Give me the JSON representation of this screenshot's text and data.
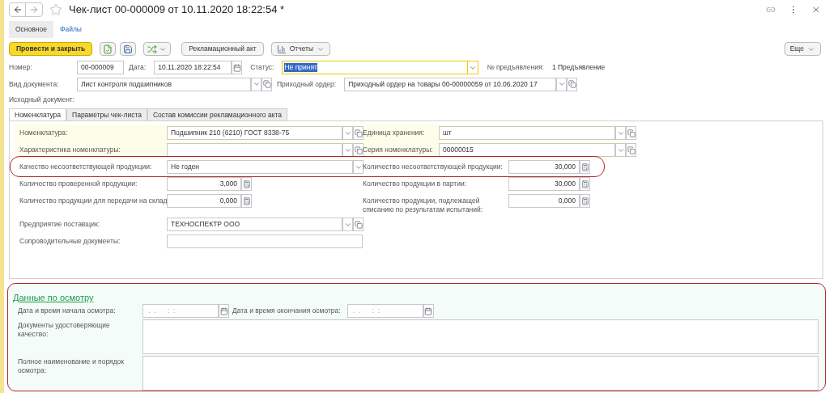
{
  "window": {
    "title": "Чек-лист 00-000009 от 10.11.2020 18:22:54 *",
    "favorite": false
  },
  "section_tabs": [
    {
      "label": "Основное",
      "selected": true
    },
    {
      "label": "Файлы",
      "selected": false
    }
  ],
  "toolbar": {
    "post_and_close": "Провести и закрыть",
    "claim_act": "Рекламационный акт",
    "reports": "Отчеты",
    "more": "Еще"
  },
  "header": {
    "number": {
      "label": "Номер:",
      "value": "00-000009"
    },
    "date": {
      "label": "Дата:",
      "value": "10.11.2020 18:22:54"
    },
    "status": {
      "label": "Статус:",
      "value": "Не принят",
      "text_selected": true
    },
    "presentation": {
      "label": "№ предъявления:",
      "value": "1 Предъявление"
    },
    "document_type": {
      "label": "Вид документа:",
      "value": "Лист контроля подшипников"
    },
    "receipt_order": {
      "label": "Приходный ордер:",
      "value": "Приходный ордер на товары 00-00000059 от 10.06.2020 17"
    },
    "source_document": {
      "label": "Исходный документ:"
    }
  },
  "tabs": [
    {
      "label": "Номенклатура",
      "selected": true
    },
    {
      "label": "Параметры чек-листа",
      "selected": false
    },
    {
      "label": "Состав комиссии рекламационного акта",
      "selected": false
    }
  ],
  "rows": [
    {
      "tinted": true,
      "left": {
        "kind": "select",
        "label": "Номенклатура:",
        "value": "Подшипник 210 (6210) ГОСТ 8338-75"
      },
      "right": {
        "kind": "select",
        "label": "Единица хранения:",
        "value": "шт"
      }
    },
    {
      "tinted": true,
      "left": {
        "kind": "select",
        "label": "Характеристика номенклатуры:"
      },
      "right": {
        "kind": "select",
        "label": "Серия номенклатуры:",
        "value": "00000015"
      }
    },
    {
      "highlighted": true,
      "left": {
        "kind": "choice",
        "label": "Качество несоответствующей продукции:",
        "value": "Не годен"
      },
      "right": {
        "kind": "number",
        "label": "Количество несоответствующей продукции:",
        "value": "30,000"
      }
    },
    {
      "left": {
        "kind": "number",
        "label": "Количество проверенной продукции:",
        "value": "3,000"
      },
      "right": {
        "kind": "number",
        "label": "Количество продукции в партии:",
        "value": "30,000"
      }
    },
    {
      "left": {
        "kind": "number",
        "label": "Количество продукции для передачи на склад:",
        "value": "0,000"
      },
      "right": {
        "kind": "number",
        "label": "Количество продукции, подлежащей списанию по результатам испытаний:",
        "value": "0,000"
      }
    },
    {
      "left": {
        "kind": "select",
        "label": "Предприятие поставщик:",
        "value": "ТЕХНОСПЕКТР ООО"
      }
    },
    {
      "left": {
        "kind": "text",
        "label": "Сопроводительные документы:"
      }
    }
  ],
  "inspection": {
    "title": "Данные по осмотру",
    "highlighted": true,
    "date_fields": [
      {
        "label": "Дата и время начала осмотра:",
        "placeholder": " .  .      :  :"
      },
      {
        "label": "Дата и время окончания осмотра:",
        "placeholder": " .  .      :  :"
      }
    ],
    "text_areas": [
      {
        "label": "Документы удостоверяющие качество:"
      },
      {
        "label": "Полное наименование и порядок осмотра:"
      }
    ]
  }
}
